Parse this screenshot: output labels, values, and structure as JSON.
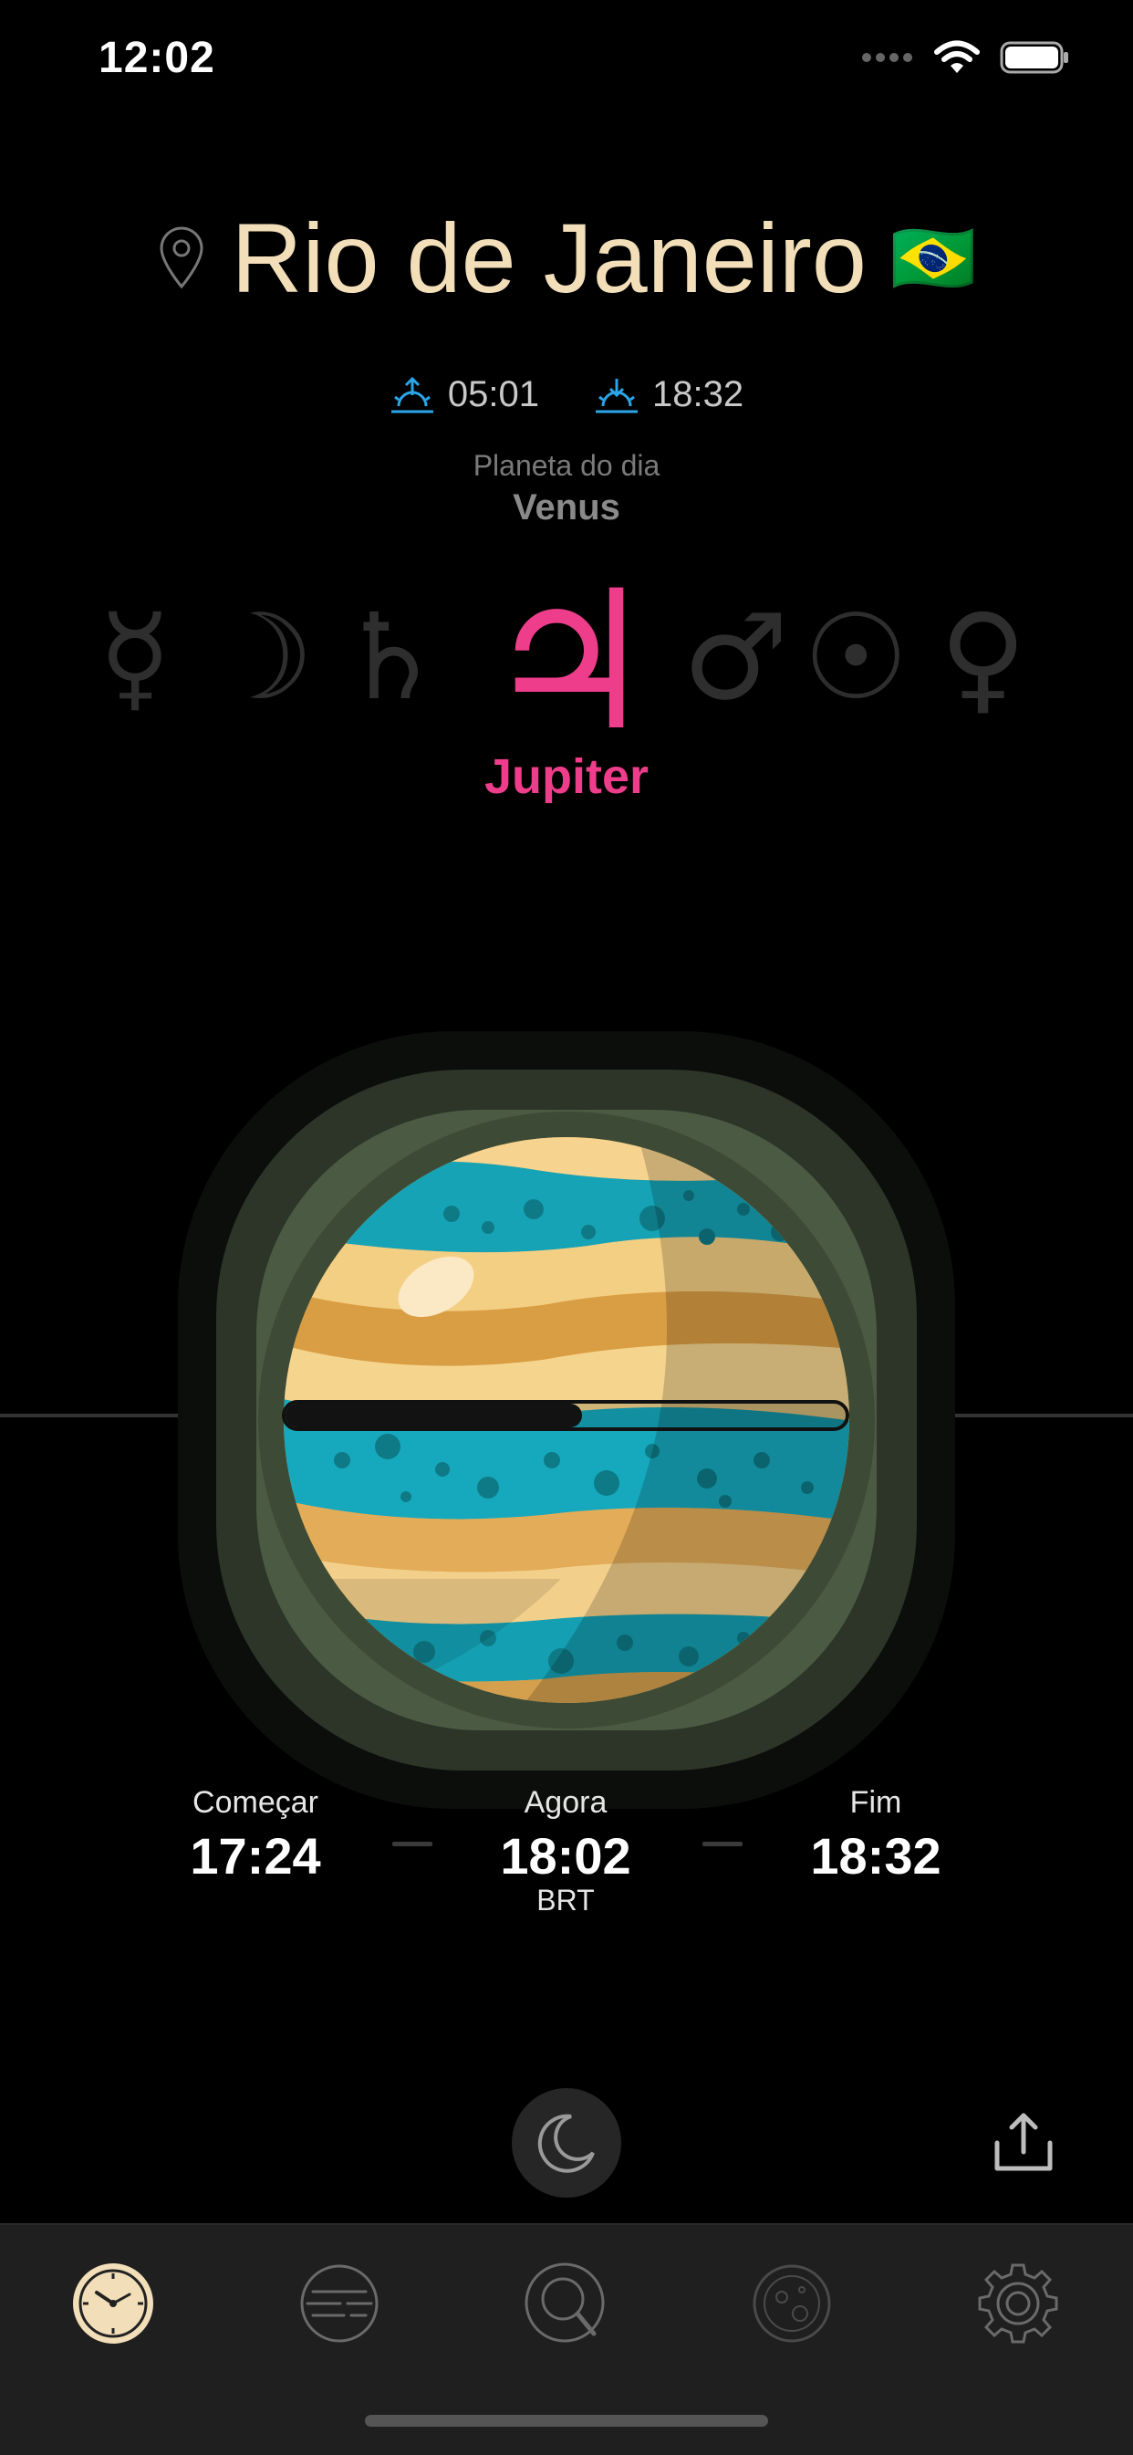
{
  "status_bar": {
    "time": "12:02"
  },
  "location": {
    "city": "Rio de Janeiro",
    "flag": "🇧🇷"
  },
  "sun": {
    "sunrise": "05:01",
    "sunset": "18:32"
  },
  "planet_of_day": {
    "label": "Planeta do dia",
    "value": "Venus"
  },
  "planet_symbols": {
    "mercury": "☿",
    "moon": "☽",
    "saturn": "♄",
    "jupiter": "♃",
    "mars": "♂",
    "sun": "☉",
    "venus": "♀"
  },
  "current_hour": {
    "planet": "Jupiter",
    "progress": 0.53
  },
  "times": {
    "start_label": "Começar",
    "start_value": "17:24",
    "now_label": "Agora",
    "now_value": "18:02",
    "timezone": "BRT",
    "end_label": "Fim",
    "end_value": "18:32"
  },
  "colors": {
    "accent": "#ee3d8a",
    "city": "#f2deb8",
    "sun_icon": "#2aa6e8"
  },
  "tabs": [
    "clock-icon",
    "lines-icon",
    "search-planet-icon",
    "moon-planet-icon",
    "gear-icon"
  ]
}
